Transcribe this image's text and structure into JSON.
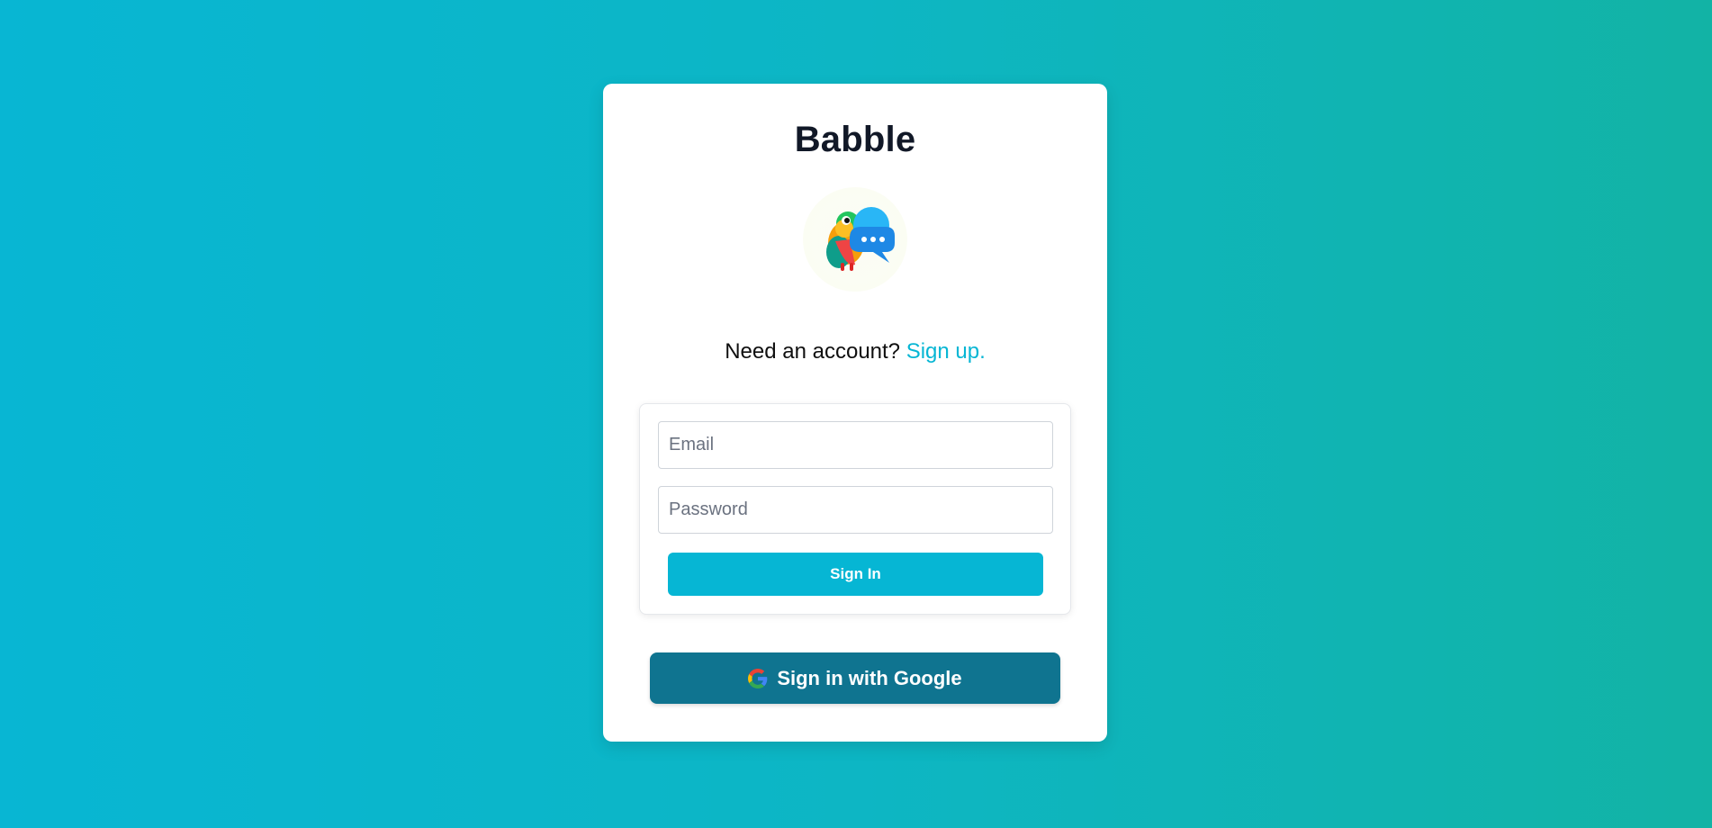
{
  "app": {
    "title": "Babble",
    "logo_icon": "parrot-chat-bubble-logo"
  },
  "signup_prompt": {
    "text": "Need an account? ",
    "link_label": "Sign up."
  },
  "form": {
    "email_placeholder": "Email",
    "email_value": "",
    "password_placeholder": "Password",
    "password_value": "",
    "signin_label": "Sign In"
  },
  "google": {
    "label": "Sign in with Google",
    "icon": "google-icon"
  },
  "colors": {
    "accent": "#06b6d4",
    "google_button": "#0f7490",
    "background_start": "#08b6d3",
    "background_end": "#12b3a5",
    "title_text": "#111827"
  }
}
